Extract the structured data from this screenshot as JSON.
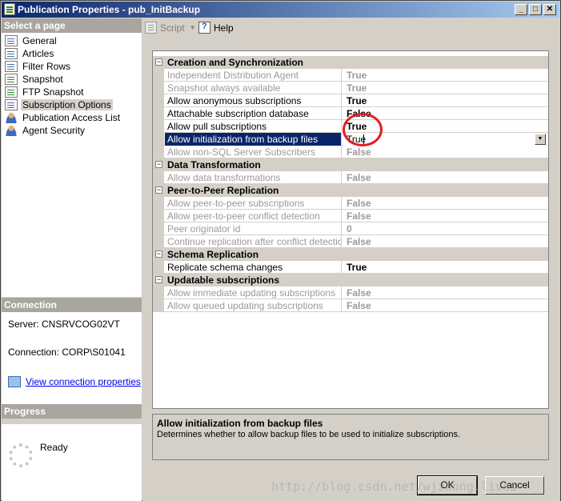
{
  "window": {
    "title": "Publication Properties - pub_InitBackup",
    "controls": {
      "minimize": "_",
      "maximize": "□",
      "close": "✕"
    }
  },
  "left_panel": {
    "select_page_header": "Select a page",
    "pages": [
      {
        "label": "General",
        "icon": "page-icon"
      },
      {
        "label": "Articles",
        "icon": "page-icon"
      },
      {
        "label": "Filter Rows",
        "icon": "page-icon"
      },
      {
        "label": "Snapshot",
        "icon": "page-icon"
      },
      {
        "label": "FTP Snapshot",
        "icon": "page-icon"
      },
      {
        "label": "Subscription Options",
        "icon": "page-icon",
        "selected": true
      },
      {
        "label": "Publication Access List",
        "icon": "user-icon"
      },
      {
        "label": "Agent Security",
        "icon": "user-icon"
      }
    ],
    "connection_header": "Connection",
    "server": "Server: CNSRVCOG02VT",
    "connection": "Connection: CORP\\S01041",
    "view_connection_link": "View connection properties",
    "progress_header": "Progress",
    "progress_status": "Ready"
  },
  "toolbar": {
    "script_label": "Script",
    "help_label": "Help"
  },
  "grid": {
    "selected_value": "True",
    "rows": [
      {
        "type": "category",
        "label": "Creation and Synchronization"
      },
      {
        "type": "prop",
        "name": "Independent Distribution Agent",
        "value": "True",
        "readonly": true
      },
      {
        "type": "prop",
        "name": "Snapshot always available",
        "value": "True",
        "readonly": true
      },
      {
        "type": "prop",
        "name": "Allow anonymous subscriptions",
        "value": "True",
        "readonly": false
      },
      {
        "type": "prop",
        "name": "Attachable subscription database",
        "value": "False",
        "readonly": false
      },
      {
        "type": "prop",
        "name": "Allow pull subscriptions",
        "value": "True",
        "readonly": false
      },
      {
        "type": "prop",
        "name": "Allow initialization from backup files",
        "value": "True",
        "readonly": false,
        "selected": true
      },
      {
        "type": "prop",
        "name": "Allow non-SQL Server Subscribers",
        "value": "False",
        "readonly": true
      },
      {
        "type": "category",
        "label": "Data Transformation"
      },
      {
        "type": "prop",
        "name": "Allow data transformations",
        "value": "False",
        "readonly": true
      },
      {
        "type": "category",
        "label": "Peer-to-Peer Replication"
      },
      {
        "type": "prop",
        "name": "Allow peer-to-peer subscriptions",
        "value": "False",
        "readonly": true
      },
      {
        "type": "prop",
        "name": "Allow peer-to-peer conflict detection",
        "value": "False",
        "readonly": true
      },
      {
        "type": "prop",
        "name": "Peer originator id",
        "value": "0",
        "readonly": true
      },
      {
        "type": "prop",
        "name": "Continue replication after conflict detection",
        "value": "False",
        "readonly": true
      },
      {
        "type": "category",
        "label": "Schema Replication"
      },
      {
        "type": "prop",
        "name": "Replicate schema changes",
        "value": "True",
        "readonly": false
      },
      {
        "type": "category",
        "label": "Updatable subscriptions"
      },
      {
        "type": "prop",
        "name": "Allow immediate updating subscriptions",
        "value": "False",
        "readonly": true
      },
      {
        "type": "prop",
        "name": "Allow queued updating subscriptions",
        "value": "False",
        "readonly": true
      }
    ]
  },
  "description": {
    "title": "Allow initialization from backup files",
    "text": "Determines whether to allow backup files to be used to initialize subscriptions."
  },
  "buttons": {
    "ok": "OK",
    "cancel": "Cancel"
  },
  "watermark": "http://blog.csdn.net/wjzhong.lives",
  "colors": {
    "selection": "#0a246a",
    "annotation_circle": "#e02020",
    "link": "#0000ee"
  }
}
